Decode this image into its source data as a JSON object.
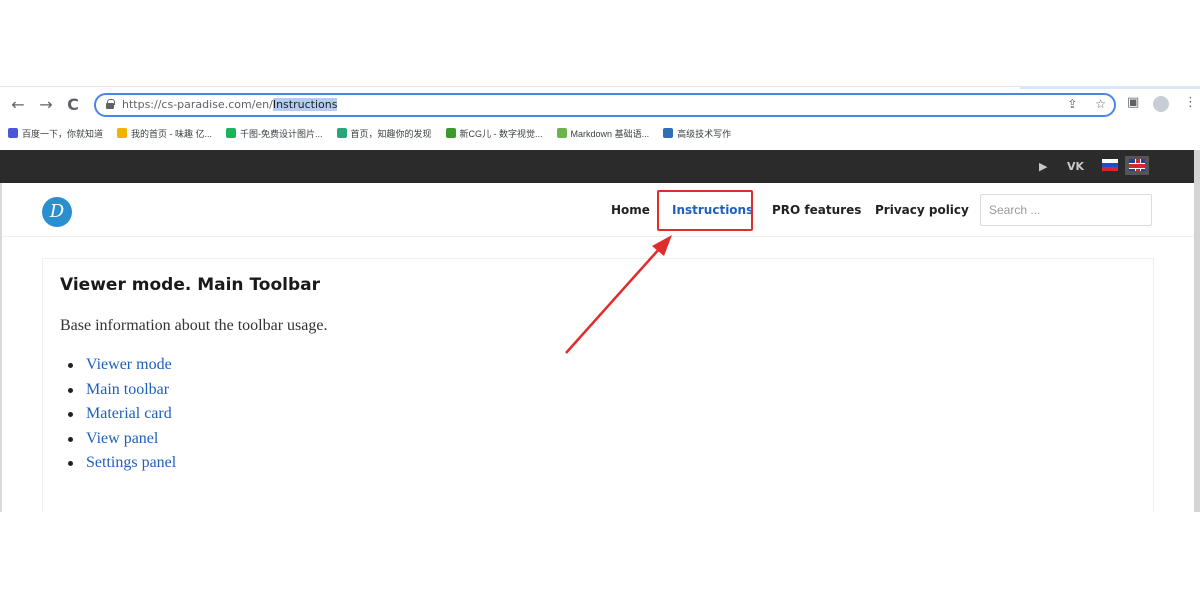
{
  "browser": {
    "back_icon": "←",
    "forward_icon": "→",
    "reload_icon": "C",
    "url_prefix": "https://cs-paradise.com/en/",
    "url_selected": "Instructions",
    "share_icon": "⇪",
    "star_icon": "☆",
    "sidepanel_icon": "▣",
    "menu_icon": "⋮"
  },
  "bookmarks": [
    {
      "label": "百度一下，你就知道",
      "color": "#4b57d8"
    },
    {
      "label": "我的首页 - 味趣 亿...",
      "color": "#f2b300"
    },
    {
      "label": "千图-免费设计图片...",
      "color": "#19b35a"
    },
    {
      "label": "首页，知趣你的发现",
      "color": "#2aa57a"
    },
    {
      "label": "新CG儿 - 数字视觉...",
      "color": "#3a9a2d"
    },
    {
      "label": "Markdown 基础语...",
      "color": "#6bb34a"
    },
    {
      "label": "高级技术写作",
      "color": "#2f6fb5"
    }
  ],
  "topbar": {
    "youtube_icon": "▶",
    "vk_label": "VK"
  },
  "site": {
    "logo_letter": "D",
    "nav": {
      "home": "Home",
      "instructions": "Instructions",
      "pro": "PRO features",
      "privacy": "Privacy policy"
    },
    "search_placeholder": "Search ..."
  },
  "content": {
    "title": "Viewer mode. Main Toolbar",
    "description": "Base information about the toolbar usage.",
    "links": [
      "Viewer mode",
      "Main toolbar",
      "Material card",
      "View panel",
      "Settings panel"
    ]
  },
  "colors": {
    "accent": "#1f5fbf",
    "annotation": "#e22b2b",
    "topbar": "#2b2b2b"
  }
}
